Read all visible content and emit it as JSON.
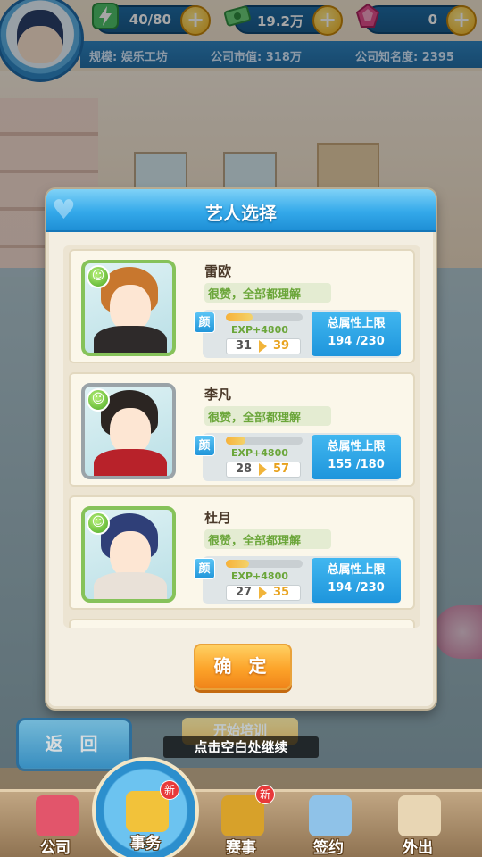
{
  "hud": {
    "energy": "40/80",
    "money": "19.2万",
    "gems": "0",
    "plus": "+",
    "scale": "规模: 娱乐工坊",
    "market_value": "公司市值: 318万",
    "fame": "公司知名度: 2395"
  },
  "modal": {
    "title": "艺人选择",
    "confirm_label": "确 定",
    "artists": [
      {
        "name": "雷欧",
        "comment": "很赞，全部都理解",
        "face_label": "颜",
        "exp": "EXP+4800",
        "exp_progress": 0.35,
        "level": "31",
        "level_max": "39",
        "attr_label": "总属性上限",
        "attr": "194 /230",
        "hair": "#c8772e",
        "outfit": "#2e2a2a",
        "frame": "green"
      },
      {
        "name": "李凡",
        "comment": "很赞，全部都理解",
        "face_label": "颜",
        "exp": "EXP+4800",
        "exp_progress": 0.25,
        "level": "28",
        "level_max": "57",
        "attr_label": "总属性上限",
        "attr": "155 /180",
        "hair": "#2b2522",
        "outfit": "#b8222a",
        "frame": "gray"
      },
      {
        "name": "杜月",
        "comment": "很赞，全部都理解",
        "face_label": "颜",
        "exp": "EXP+4800",
        "exp_progress": 0.3,
        "level": "27",
        "level_max": "35",
        "attr_label": "总属性上限",
        "attr": "194 /230",
        "hair": "#2f3f78",
        "outfit": "#e9e1d8",
        "frame": "green"
      }
    ]
  },
  "mood_icon": "smile-icon",
  "back_label": "返 回",
  "train_label": "开始培训",
  "hint": "点击空白处继续",
  "nav": {
    "items": [
      {
        "label": "公司",
        "icon": "company-icon",
        "color": "#e2556b"
      },
      {
        "label": "事务",
        "icon": "affairs-icon",
        "color": "#f2c23a",
        "badge": "新"
      },
      {
        "label": "赛事",
        "icon": "trophy-icon",
        "color": "#d7a12a",
        "badge": "新"
      },
      {
        "label": "签约",
        "icon": "contract-icon",
        "color": "#8fc2e8"
      },
      {
        "label": "外出",
        "icon": "door-icon",
        "color": "#e8d6b4"
      }
    ]
  },
  "colors": {
    "accent_blue": "#34a9ea",
    "confirm_orange": "#fca329",
    "positive_green": "#6ba63a"
  }
}
